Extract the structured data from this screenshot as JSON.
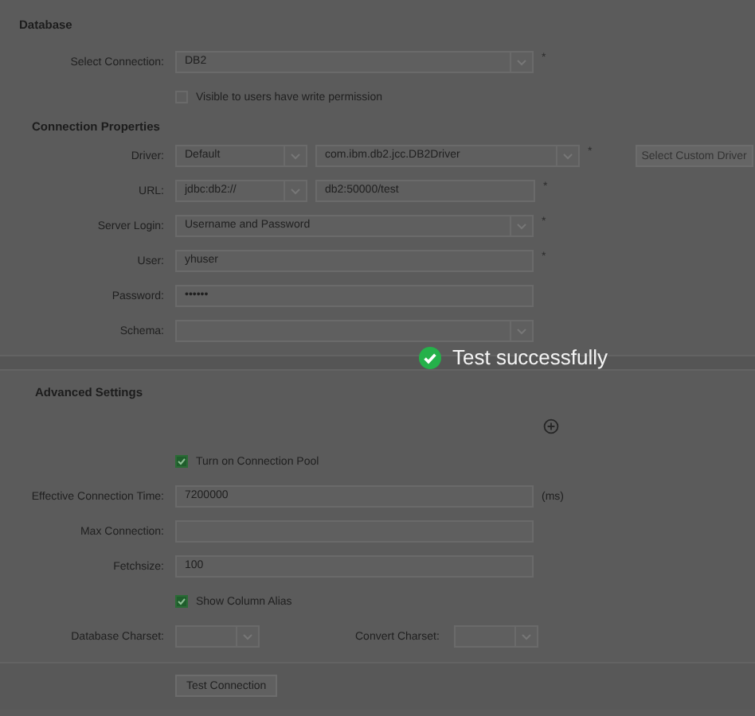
{
  "sections": [
    {
      "title": "Database",
      "kind": "top",
      "rows": [
        {
          "kind": "fields",
          "label": "Select Connection:",
          "fields": [
            {
              "kind": "select",
              "value": "DB2"
            }
          ],
          "marker": "*"
        },
        {
          "kind": "checkbox",
          "label": "Visible to users have write permission",
          "checked": false
        }
      ]
    },
    {
      "title": "Connection Properties",
      "kind": "sub",
      "rows": [
        {
          "kind": "fields",
          "label": "Driver:",
          "fields": [
            {
              "kind": "select",
              "value": "Default"
            },
            {
              "kind": "select",
              "value": "com.ibm.db2.jcc.DB2Driver"
            }
          ],
          "marker": "*",
          "button": {
            "label": "Select Custom Driver",
            "disabled": true
          }
        },
        {
          "kind": "fields",
          "label": "URL:",
          "fields": [
            {
              "kind": "select",
              "value": "jdbc:db2://"
            },
            {
              "kind": "text",
              "value": "db2:50000/test"
            }
          ],
          "marker": "*"
        },
        {
          "kind": "fields",
          "label": "Server Login:",
          "fields": [
            {
              "kind": "select",
              "value": "Username and Password"
            }
          ],
          "marker": "*"
        },
        {
          "kind": "fields",
          "label": "User:",
          "fields": [
            {
              "kind": "text",
              "value": "yhuser"
            }
          ],
          "marker": "*"
        },
        {
          "kind": "fields",
          "label": "Password:",
          "fields": [
            {
              "kind": "text",
              "value": "••••••"
            }
          ]
        },
        {
          "kind": "fields",
          "label": "Schema:",
          "fields": [
            {
              "kind": "select"
            }
          ]
        }
      ]
    },
    {
      "title": "Advanced Settings",
      "kind": "divided",
      "rows": [
        {
          "kind": "add"
        },
        {
          "kind": "checkbox",
          "label": "Turn on Connection Pool",
          "checked": true
        },
        {
          "kind": "fields",
          "label": "Effective Connection Time:",
          "fields": [
            {
              "kind": "text",
              "value": "7200000"
            }
          ],
          "suffix": "(ms)"
        },
        {
          "kind": "fields",
          "label": "Max Connection:",
          "fields": [
            {
              "kind": "text"
            }
          ]
        },
        {
          "kind": "fields",
          "label": "Fetchsize:",
          "fields": [
            {
              "kind": "text",
              "value": "100"
            }
          ]
        },
        {
          "kind": "checkbox",
          "label": "Show Column Alias",
          "checked": true
        },
        {
          "kind": "pair",
          "label": "Database Charset:",
          "label2": "Convert Charset:"
        }
      ]
    }
  ],
  "footer_button": "Test Connection",
  "toast": "Test successfully"
}
